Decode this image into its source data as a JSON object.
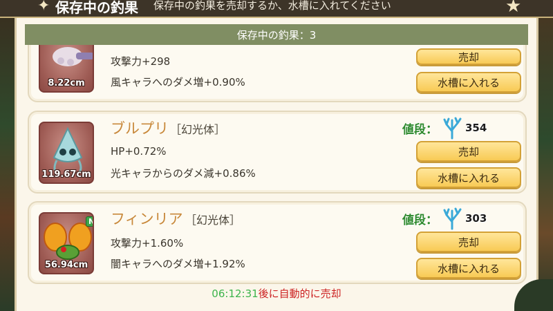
{
  "header": {
    "title": "保存中の釣果",
    "description": "保存中の釣果を売却するか、水槽に入れてください"
  },
  "count_bar": {
    "text": "保存中の釣果：3"
  },
  "colors": {
    "count_bar_bg": "#808e63",
    "fish_name": "#c8883a",
    "price_label": "#2e8a2e",
    "button_bg": "#f8ca55",
    "timer_time": "#3cb44b",
    "timer_text": "#cc2222"
  },
  "items": [
    {
      "size": "8.22cm",
      "stat1": "攻撃力+298",
      "stat2": "風キャラへのダメ増+0.90%",
      "sell_label": "売却",
      "tank_label": "水槽に入れる",
      "new": false
    },
    {
      "name": "ブルプリ",
      "type": "［幻光体］",
      "size": "119.67cm",
      "stat1": "HP+0.72%",
      "stat2": "光キャラからのダメ減+0.86%",
      "price_label": "値段：",
      "price_icon": "coral-icon",
      "price": "354",
      "sell_label": "売却",
      "tank_label": "水槽に入れる",
      "new": false
    },
    {
      "name": "フィンリア",
      "type": "［幻光体］",
      "size": "56.94cm",
      "stat1": "攻撃力+1.60%",
      "stat2": "闇キャラへのダメ増+1.92%",
      "price_label": "値段：",
      "price_icon": "coral-icon",
      "price": "303",
      "sell_label": "売却",
      "tank_label": "水槽に入れる",
      "new": true,
      "new_label": "New"
    }
  ],
  "timer": {
    "time": "06:12:31",
    "suffix": "後に自動的に売却"
  }
}
